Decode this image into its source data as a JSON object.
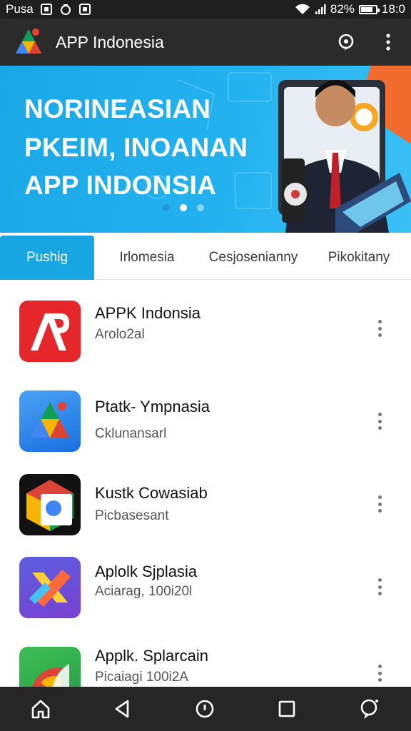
{
  "status_bar": {
    "carrier": "Pusa",
    "battery_text": "82%",
    "battery_level": 0.82,
    "time": "18:0"
  },
  "app_bar": {
    "title": "APP Indonesia",
    "logo_icon": "triangle-logo-icon",
    "actions": [
      "search-chat-icon",
      "more-vert-icon"
    ]
  },
  "banner": {
    "lines": [
      "NORINEASIAN",
      "PKEIM, INOANAN",
      "APP INDONSIA"
    ],
    "slide_count": 3,
    "active_slide": 1
  },
  "tabs": [
    {
      "label": "Pushig",
      "active": true
    },
    {
      "label": "Irlomesia",
      "active": false
    },
    {
      "label": "Cesjosenianny",
      "active": false
    },
    {
      "label": "Pikokitany",
      "active": false
    }
  ],
  "apps": [
    {
      "title": "APPK Indonsia",
      "subtitle": "Arolo2al",
      "icon": "app-red-a-icon"
    },
    {
      "title": "Ptatk- Ympnasia",
      "subtitle": "Cklunansarl",
      "icon": "app-blue-triangle-icon"
    },
    {
      "title": "Kustk Cowasiab",
      "subtitle": "Picbasesant",
      "icon": "app-chrome-hex-icon"
    },
    {
      "title": "Aplolk Sjplasia",
      "subtitle": "Aciarag, 100i20l",
      "icon": "app-purple-x-icon"
    },
    {
      "title": "Applk. Splarcain",
      "subtitle": "Picaiagi 100i2A",
      "icon": "app-green-leaf-icon"
    }
  ],
  "colors": {
    "accent": "#18a6e3",
    "app_bar": "#2b2b2b",
    "status_bar": "#1f1f1f",
    "nav_bar": "#262626"
  },
  "nav_bar": [
    "home-icon",
    "back-icon",
    "assistant-icon",
    "recents-icon",
    "profile-icon"
  ]
}
